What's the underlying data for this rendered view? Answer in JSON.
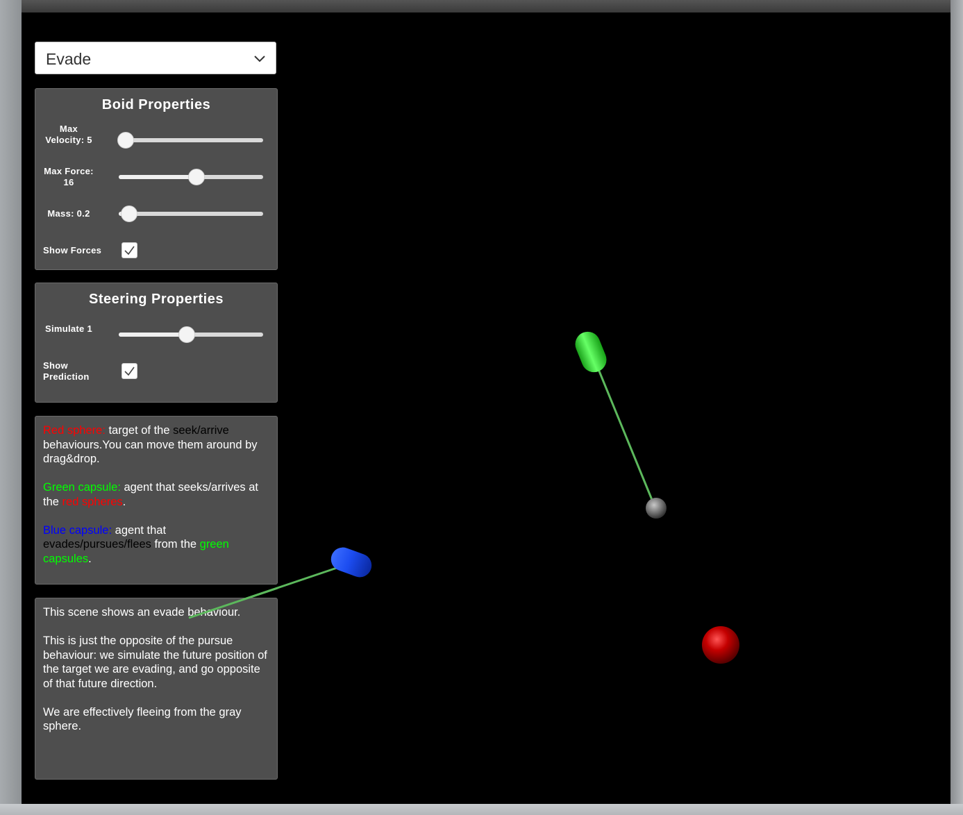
{
  "mode_dropdown": {
    "selected": "Evade"
  },
  "boid_panel": {
    "title": "Boid Properties",
    "max_velocity": {
      "label": "Max Velocity: 5",
      "value": 0.05
    },
    "max_force": {
      "label": "Max Force: 16",
      "value": 0.54
    },
    "mass": {
      "label": "Mass: 0.2",
      "value": 0.07
    },
    "show_forces": {
      "label": "Show Forces",
      "checked": true
    }
  },
  "steering_panel": {
    "title": "Steering Properties",
    "simulate": {
      "label": "Simulate 1",
      "value": 0.47
    },
    "show_prediction": {
      "label": "Show Prediction",
      "checked": true
    }
  },
  "legend_panel": {
    "p1": {
      "a": "Red sphere:",
      "b": " target of the ",
      "c": "seek/arrive",
      "d": " behaviours.You can move them around by drag&drop."
    },
    "p2": {
      "a": "Green capsule:",
      "b": " agent that seeks/arrives at the ",
      "c": "red spheres",
      "d": "."
    },
    "p3": {
      "a": "Blue capsule:",
      "b": " agent that ",
      "c": "evades/pursues/flees",
      "d": " from the ",
      "e": "green capsules",
      "f": "."
    }
  },
  "description_panel": {
    "p1": "This scene shows an evade behaviour.",
    "p2": "This is just the opposite of the pursue behaviour: we simulate the future position of the target we are evading, and go opposite of that future direction.",
    "p3": "We are effectively fleeing from the gray sphere."
  },
  "colors": {
    "panel_bg": "#4e4e4e",
    "red_sphere": "#c00000",
    "green_capsule": "#22dd22",
    "blue_capsule": "#1040f0",
    "force_line": "#5cb85c"
  }
}
